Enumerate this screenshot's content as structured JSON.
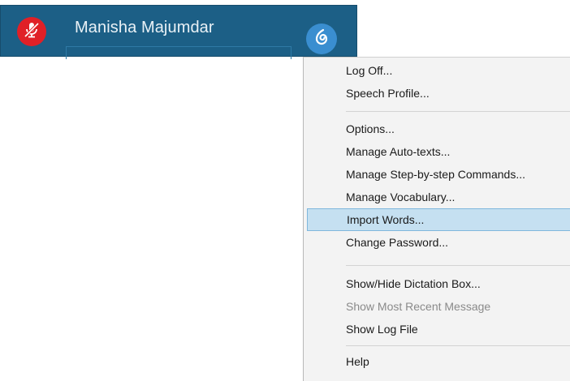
{
  "dictation_bar": {
    "user_name": "Manisha Majumdar",
    "mic_icon": "microphone-off-icon",
    "dragon_icon": "dragon-flame-icon",
    "colors": {
      "bar": "#1c5f86",
      "mic": "#e02027",
      "dragon": "#3a8ed0"
    }
  },
  "menu": {
    "items": [
      {
        "label": "Log Off..."
      },
      {
        "label": "Speech Profile..."
      },
      {
        "label": "Options..."
      },
      {
        "label": "Manage Auto-texts..."
      },
      {
        "label": "Manage Step-by-step Commands..."
      },
      {
        "label": "Manage Vocabulary..."
      },
      {
        "label": "Import Words..."
      },
      {
        "label": "Change Password..."
      },
      {
        "label": "Show/Hide Dictation Box..."
      },
      {
        "label": "Show Most Recent Message"
      },
      {
        "label": "Show Log File"
      },
      {
        "label": "Help"
      }
    ],
    "highlighted_item": "Import Words...",
    "disabled_item": "Show Most Recent Message",
    "highlight_color": "#c5e0f1"
  }
}
